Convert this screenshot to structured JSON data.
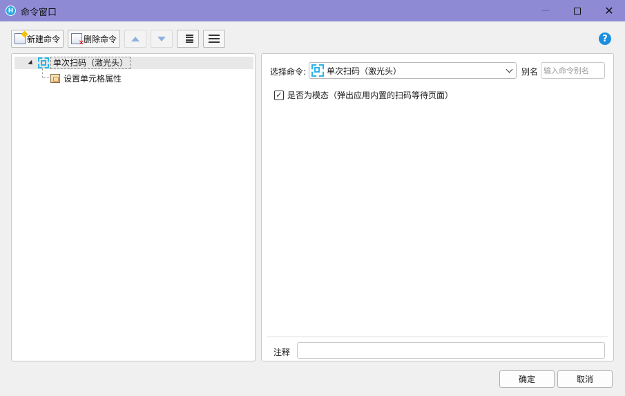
{
  "window": {
    "title": "命令窗口",
    "app_icon_letter": "H",
    "close_glyph": "✕"
  },
  "toolbar": {
    "new_label": "新建命令",
    "delete_label": "删除命令",
    "help_glyph": "?"
  },
  "tree": {
    "items": [
      {
        "label": "单次扫码（激光头）",
        "icon": "scan-icon",
        "selected": true
      },
      {
        "label": "设置单元格属性",
        "icon": "table-cell-icon"
      }
    ]
  },
  "form": {
    "select_label": "选择命令:",
    "selected_command": "单次扫码（激光头）",
    "alias_label": "别名",
    "alias_placeholder": "输入命令别名",
    "modal_checkbox_label": "是否为模态（弹出应用内置的扫码等待页面）",
    "modal_checked": true,
    "checkmark_glyph": "✓",
    "note_label": "注释"
  },
  "footer": {
    "ok_label": "确定",
    "cancel_label": "取消"
  },
  "colors": {
    "titlebar": "#8e8ad4",
    "accent": "#1a8fe0",
    "scan_icon": "#2ab4e6"
  }
}
